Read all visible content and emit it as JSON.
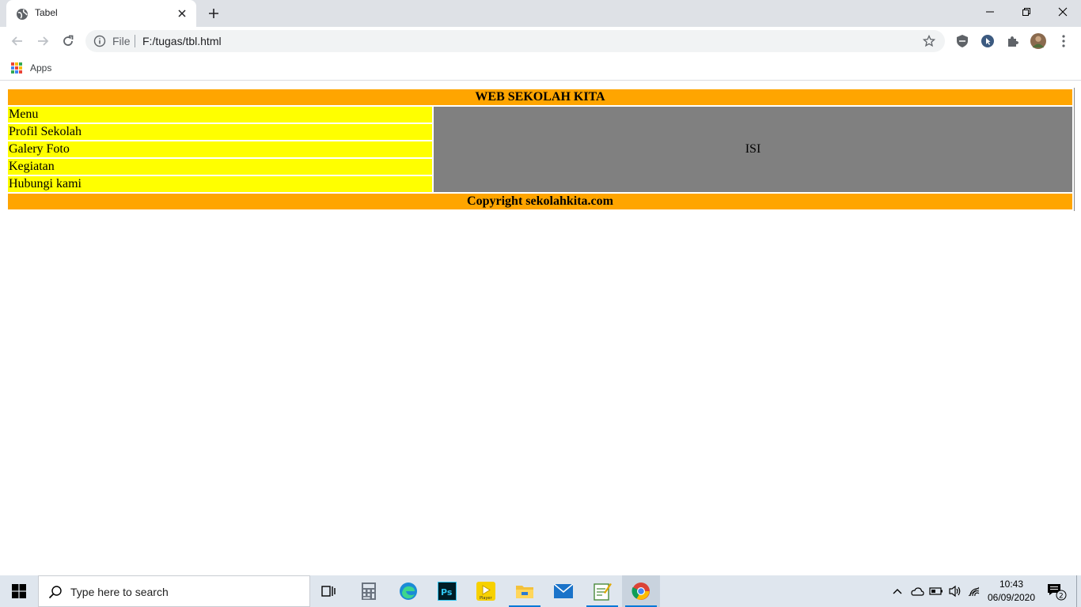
{
  "browser": {
    "tab_title": "Tabel",
    "scheme_label": "File",
    "url": "F:/tugas/tbl.html",
    "bookmarks": {
      "apps_label": "Apps"
    }
  },
  "page": {
    "header": "WEB SEKOLAH KITA",
    "menu_items": [
      "Menu",
      "Profil Sekolah",
      "Galery Foto",
      "Kegiatan",
      "Hubungi kami"
    ],
    "content": "ISI",
    "footer": "Copyright sekolahkita.com",
    "colors": {
      "header_bg": "#ffa500",
      "menu_bg": "#ffff00",
      "content_bg": "#808080",
      "footer_bg": "#ffa500"
    }
  },
  "taskbar": {
    "search_placeholder": "Type here to search",
    "clock_time": "10:43",
    "clock_date": "06/09/2020",
    "notification_count": "2",
    "pinned_icons": [
      "task-view-icon",
      "calculator-icon",
      "edge-icon",
      "photoshop-icon",
      "player-icon",
      "file-explorer-icon",
      "mail-icon",
      "notepad-icon",
      "chrome-icon"
    ],
    "player_label": "Player",
    "photoshop_label": "Ps"
  }
}
